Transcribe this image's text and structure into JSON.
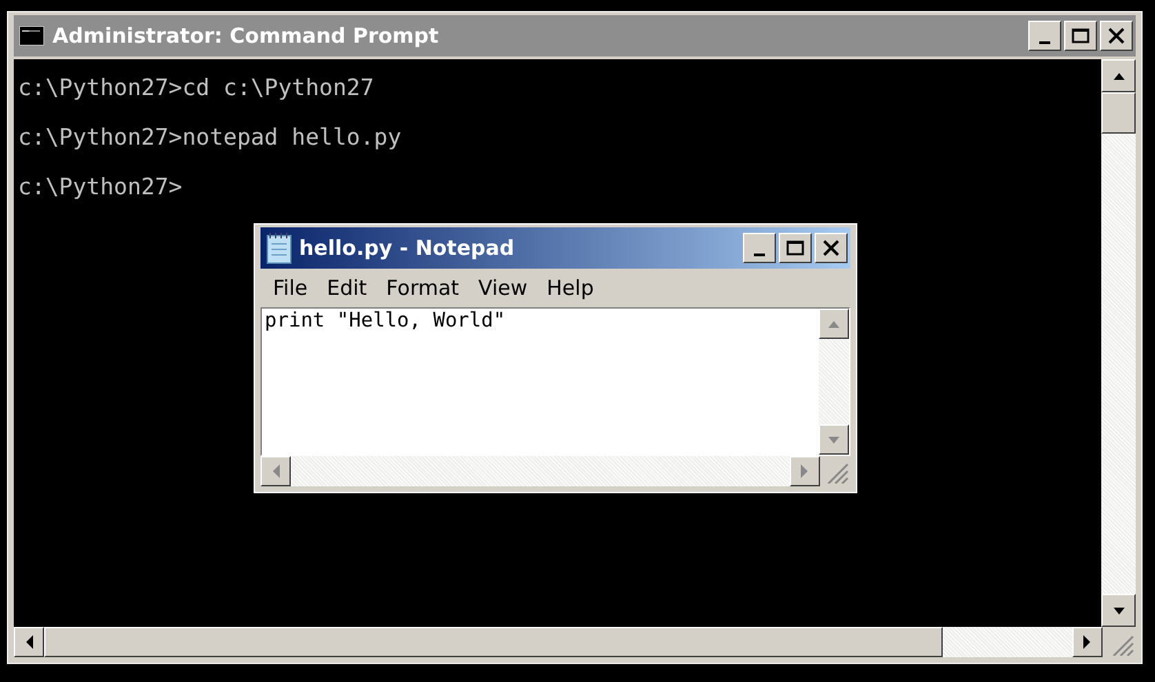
{
  "console_window": {
    "title": "Administrator: Command Prompt",
    "active": false,
    "lines": [
      "c:\\Python27>cd c:\\Python27",
      "c:\\Python27>notepad hello.py",
      "c:\\Python27>"
    ]
  },
  "notepad_window": {
    "title": "hello.py - Notepad",
    "active": true,
    "menu": [
      "File",
      "Edit",
      "Format",
      "View",
      "Help"
    ],
    "text": "print \"Hello, World\""
  }
}
